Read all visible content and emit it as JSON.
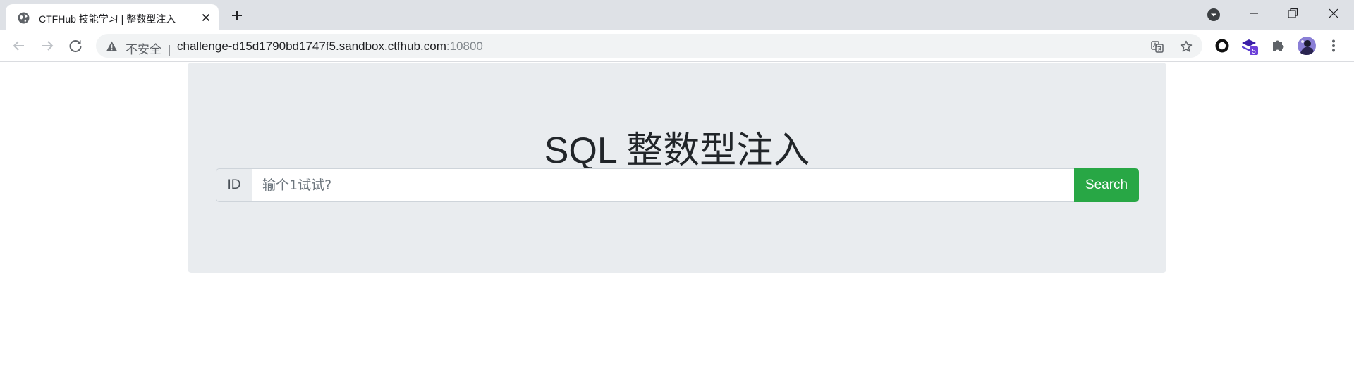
{
  "browser": {
    "tab": {
      "title": "CTFHub 技能学习 | 整数型注入",
      "favicon": "globe-icon"
    },
    "omnibox": {
      "security_label": "不安全",
      "separator": "|",
      "host": "challenge-d15d1790bd1747f5.sandbox.ctfhub.com",
      "port": ":10800"
    },
    "extension_badge": "5"
  },
  "page": {
    "heading": "SQL 整数型注入",
    "id_label": "ID",
    "input_value": "",
    "input_placeholder": "输个1试试?",
    "search_label": "Search"
  },
  "colors": {
    "jumbotron": "#e9ecef",
    "search_button": "#28a745",
    "tabstrip": "#dee1e6",
    "omnibox": "#f1f3f4"
  }
}
